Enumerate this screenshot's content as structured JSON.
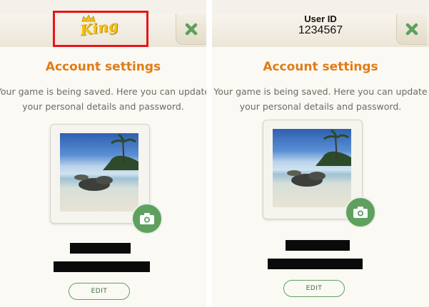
{
  "left_panel": {
    "logo_text": "King",
    "title": "Account settings",
    "description": "Your game is being saved. Here you can update your personal details and password.",
    "edit_label": "EDIT"
  },
  "right_panel": {
    "user_id_label": "User ID",
    "user_id_value": "1234567",
    "title": "Account settings",
    "description": "Your game is being saved. Here you can update your personal details and password.",
    "edit_label": "EDIT"
  },
  "icons": {
    "close": "close-icon",
    "camera": "camera-icon"
  },
  "colors": {
    "title_orange": "#e07c16",
    "accent_green": "#5fa05e",
    "highlight_red": "#e8141b",
    "logo_yellow": "#f2c21a"
  }
}
